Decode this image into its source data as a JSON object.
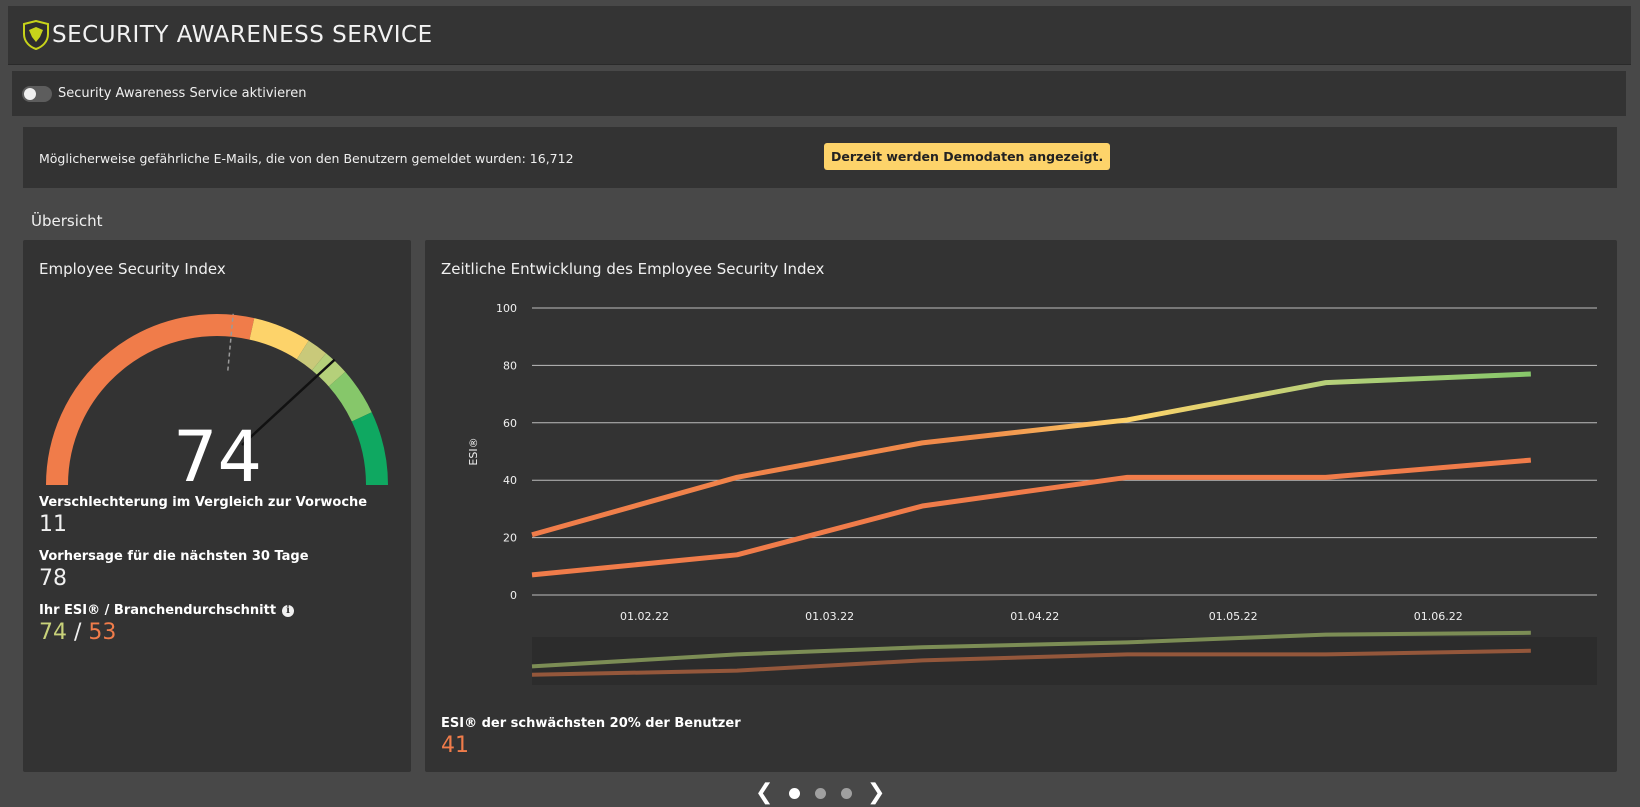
{
  "header": {
    "title": "SECURITY AWARENESS SERVICE",
    "logo_icon": "shield-logo-icon"
  },
  "toggle": {
    "label": "Security Awareness Service aktivieren",
    "enabled": false
  },
  "info": {
    "reported_text": "Möglicherweise gefährliche E-Mails, die von den Benutzern gemeldet wurden: 16,712",
    "demo_badge": "Derzeit werden Demodaten angezeigt."
  },
  "overview": {
    "title": "Übersicht"
  },
  "esi_card": {
    "title": "Employee Security Index",
    "value": "74",
    "gauge_value": 74,
    "gauge_reference": 53,
    "decline_label": "Verschlechterung im Vergleich zur Vorwoche",
    "decline_value": "11",
    "forecast_label": "Vorhersage für die nächsten 30 Tage",
    "forecast_value": "78",
    "comparison_label": "Ihr ESI® / Branchendurchschnitt",
    "your_esi": "74",
    "separator": "/",
    "industry_avg": "53",
    "colors": {
      "your": "#c9d27a",
      "industry": "#f07c4a"
    }
  },
  "trend_card": {
    "title": "Zeitliche Entwicklung des Employee Security Index",
    "weakest_label": "ESI® der schwächsten 20% der Benutzer",
    "weakest_value": "41"
  },
  "chart_data": {
    "type": "line",
    "ylabel": "ESI®",
    "ylim": [
      0,
      100
    ],
    "yticks": [
      "0",
      "20",
      "40",
      "60",
      "80",
      "100"
    ],
    "grid": true,
    "xticks": [
      "01.02.22",
      "01.03.22",
      "01.04.22",
      "01.05.22",
      "01.06.22"
    ],
    "series": [
      {
        "x": [
          "2022-01-15",
          "2022-02-15",
          "2022-03-15",
          "2022-04-15",
          "2022-05-15",
          "2022-06-15"
        ],
        "values": [
          21,
          41,
          53,
          61,
          74,
          77
        ]
      },
      {
        "x": [
          "2022-01-15",
          "2022-02-15",
          "2022-03-15",
          "2022-04-15",
          "2022-05-15",
          "2022-06-15"
        ],
        "values": [
          7,
          14,
          31,
          41,
          41,
          47
        ]
      }
    ]
  },
  "pager": {
    "pages": 3,
    "active": 1,
    "prev_icon": "chevron-left-icon",
    "next_icon": "chevron-right-icon"
  }
}
